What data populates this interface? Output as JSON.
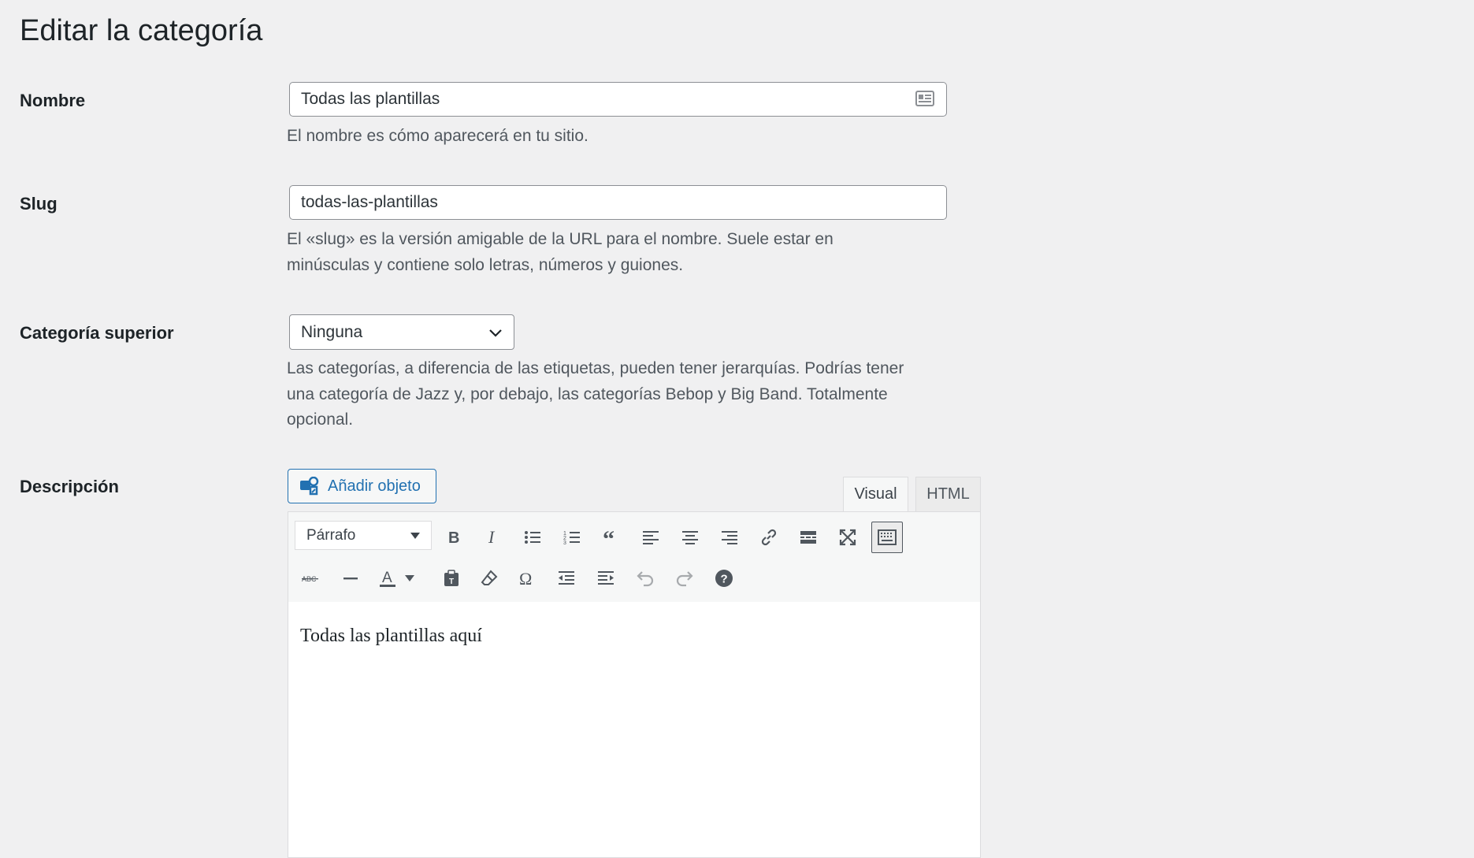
{
  "page": {
    "title": "Editar la categoría"
  },
  "fields": {
    "name": {
      "label": "Nombre",
      "value": "Todas las plantillas",
      "hint": "El nombre es cómo aparecerá en tu sitio."
    },
    "slug": {
      "label": "Slug",
      "value": "todas-las-plantillas",
      "hint_line1": "El «slug» es la versión amigable de la URL para el nombre. Suele estar en",
      "hint_line2": "minúsculas y contiene solo letras, números y guiones."
    },
    "parent": {
      "label": "Categoría superior",
      "selected": "Ninguna",
      "hint_line1": "Las categorías, a diferencia de las etiquetas, pueden tener jerarquías. Podrías tener",
      "hint_line2": "una categoría de Jazz y, por debajo, las categorías Bebop y Big Band. Totalmente",
      "hint_line3": "opcional."
    },
    "description": {
      "label": "Descripción",
      "add_media_label": "Añadir objeto",
      "tabs": {
        "visual": "Visual",
        "html": "HTML"
      },
      "format_select": "Párrafo",
      "content": "Todas las plantillas aquí"
    }
  },
  "toolbar_icons": [
    "bold-icon",
    "italic-icon",
    "bullet-list-icon",
    "numbered-list-icon",
    "blockquote-icon",
    "align-left-icon",
    "align-center-icon",
    "align-right-icon",
    "link-icon",
    "read-more-icon",
    "fullscreen-icon",
    "toolbar-toggle-icon",
    "strikethrough-icon",
    "horizontal-line-icon",
    "text-color-icon",
    "paste-text-icon",
    "clear-formatting-icon",
    "special-character-icon",
    "outdent-icon",
    "indent-icon",
    "undo-icon",
    "redo-icon",
    "help-icon"
  ],
  "colors": {
    "background": "#f0f0f1",
    "accent": "#2271b1",
    "text": "#1d2327",
    "hint": "#50575e"
  }
}
